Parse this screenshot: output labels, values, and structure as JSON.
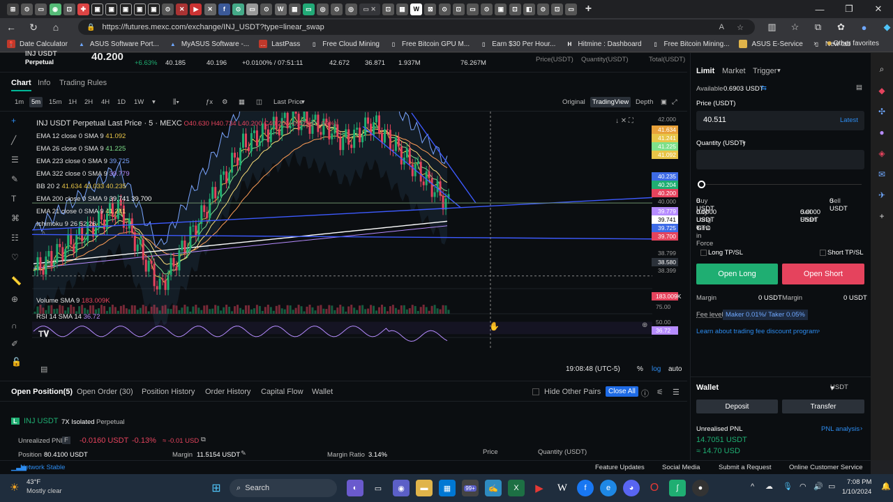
{
  "browser": {
    "url": "https://futures.mexc.com/exchange/INJ_USDT?type=linear_swap",
    "bookmarks": [
      "Date Calculator",
      "ASUS Software Port...",
      "MyASUS Software -...",
      "LastPass",
      "Free Cloud Mining",
      "Free Bitcoin GPU M...",
      "Earn $30 Per Hour...",
      "Hitmine : Dashboard",
      "Free Bitcoin Mining...",
      "ASUS E-Service",
      "New tab"
    ],
    "other_favorites": "Other favorites"
  },
  "ticker": {
    "symbol": "INJ USDT",
    "type": "Perpetual",
    "last": "40.200",
    "change": "+6.63%",
    "v1": "40.185",
    "v2": "40.196",
    "funding": "+0.0100% / 07:51:11",
    "high": "42.672",
    "low": "36.871",
    "vol": "1.937M",
    "turnover": "76.267M",
    "book_price": "Price(USDT)",
    "book_qty": "Quantity(USDT)",
    "book_total": "Total(USDT)"
  },
  "chart_tabs": [
    "Chart",
    "Info",
    "Trading Rules"
  ],
  "timeframes": [
    "1m",
    "5m",
    "15m",
    "1H",
    "2H",
    "4H",
    "1D",
    "1W"
  ],
  "views": {
    "last_price": "Last Price",
    "original": "Original",
    "tradingview": "TradingView",
    "depth": "Depth"
  },
  "legend": {
    "title": "INJ USDT Perpetual Last Price · 5 · MEXC",
    "ohlc": "O40.630 H40.734 L40.200 C40.200 -0.429 (-1.06%)",
    "rows": [
      {
        "t": "EMA 12 close 0 SMA 9",
        "v": "41.092",
        "c": "#e8c547"
      },
      {
        "t": "EMA 26 close 0 SMA 9",
        "v": "41.225",
        "c": "#7ee08a"
      },
      {
        "t": "EMA 223 close 0 SMA 9",
        "v": "39.725",
        "c": "#7aa5ff"
      },
      {
        "t": "EMA 322 close 0 SMA 9",
        "v": "39.779",
        "c": "#b68cff"
      },
      {
        "t": "BB 20 2",
        "v": "41.634  43.033  40.235",
        "c": "#e8c547"
      },
      {
        "t": "EMA 200 close 0 SMA 9",
        "v": "39.741  39.700",
        "c": "#ffffff"
      },
      {
        "t": "EMA 21 close 0 SMA 9",
        "v": "41.241",
        "c": "#ffe27a"
      },
      {
        "t": "Ichimoku 9 26 52 26",
        "v": "",
        "c": "#888888"
      }
    ],
    "volume": "Volume SMA 9",
    "volume_val": "183.009K",
    "rsi": "RSI 14 SMA 14",
    "rsi_val": "36.72"
  },
  "price_axis": [
    "42.000",
    "41.634",
    "41.241",
    "41.225",
    "41.092",
    "40.235",
    "40.204",
    "40.200",
    "40.000",
    "39.779",
    "39.741",
    "39.725",
    "39.700",
    "38.799",
    "38.580",
    "38.399"
  ],
  "sub_axis": [
    "183.009K",
    "75.00",
    "50.00",
    "36.72"
  ],
  "time_axis": [
    "12:00:00",
    "13:00:00",
    "14:00:00",
    "15:00:00",
    "16:00:00",
    "17:00:00",
    "18:00:00",
    "19:00:00",
    "21:00:00",
    "22:00:00"
  ],
  "crosshair_time": "2024-01-10  19:50:00",
  "clock": "19:08:48 (UTC-5)",
  "axis_opts": [
    "%",
    "log",
    "auto"
  ],
  "bottom_tabs": [
    "Open Position(5)",
    "Open Order (30)",
    "Position History",
    "Order History",
    "Capital Flow",
    "Wallet"
  ],
  "hide_pairs": "Hide Other Pairs",
  "close_all": "Close All",
  "position": {
    "name": "INJ USDT",
    "leverage": "7X Isolated",
    "type": "Perpetual",
    "pnl_label": "Unrealized PNL",
    "pnl": "-0.0160 USDT",
    "pnl_pct": "-0.13%",
    "pnl_usd": "≈ -0.01 USD",
    "pos_label": "Position",
    "pos_val": "80.4100 USDT",
    "margin_label": "Margin",
    "margin_val": "11.5154 USDT",
    "ratio_label": "Margin Ratio",
    "ratio_val": "3.14%",
    "price_h": "Price",
    "qty_h": "Quantity (USDT)"
  },
  "order": {
    "types": [
      "Limit",
      "Market",
      "Trigger"
    ],
    "available_label": "Available",
    "available": "0.6903 USDT",
    "price_label": "Price (USDT)",
    "price": "40.511",
    "latest": "Latest",
    "qty_label": "Quantity (USDT)",
    "buy": "Buy",
    "buy_v": "0 USDT",
    "sell": "Sell",
    "sell_v": "0 USDT",
    "buy_long": "Buy Long",
    "buy_long_v": "0.0000 USDT",
    "sell_short": "Sell Short",
    "sell_short_v": "0.0000 USDT",
    "tif": "Time in Force",
    "tif_v": "GTC",
    "long_tp": "Long TP/SL",
    "short_tp": "Short TP/SL",
    "open_long": "Open Long",
    "open_short": "Open Short",
    "margin": "Margin",
    "margin_v": "0 USDT",
    "margin2": "Margin",
    "margin2_v": "0 USDT",
    "fee_label": "Fee level",
    "fee": "Maker 0.01%/ Taker 0.05%",
    "learn": "Learn about trading fee discount program"
  },
  "wallet": {
    "title": "Wallet",
    "ccy": "USDT",
    "deposit": "Deposit",
    "transfer": "Transfer",
    "upnl": "Unrealised PNL",
    "pnl_analysis": "PNL analysis",
    "val": "14.7051 USDT",
    "usd": "≈ 14.70 USD"
  },
  "status": {
    "network": "Network Stable",
    "items": [
      "Feature Updates",
      "Social Media",
      "Submit a Request",
      "Online Customer Service"
    ]
  },
  "taskbar": {
    "temp": "43°F",
    "weather": "Mostly clear",
    "search": "Search",
    "time": "7:08 PM",
    "date": "1/10/2024",
    "badge": "99+"
  },
  "colors": {
    "accent": "#00b897",
    "long": "#1fae72",
    "short": "#e5435d",
    "link": "#2d8cf0"
  }
}
